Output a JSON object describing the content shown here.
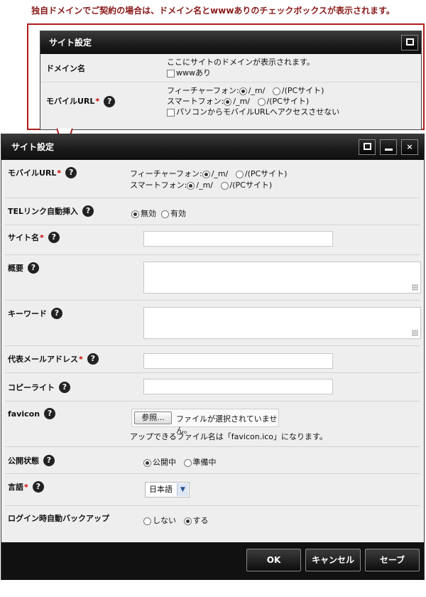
{
  "caption": "独自ドメインでご契約の場合は、ドメイン名とwwwありのチェックボックスが表示されます。",
  "back_panel": {
    "title": "サイト設定",
    "domain_label": "ドメイン名",
    "domain_text": "ここにサイトのドメインが表示されます。",
    "www_label": "wwwあり",
    "mobile_label": "モバイルURL",
    "feature_phone": "フィーチャーフォン:",
    "smart_phone": "スマートフォン:",
    "opt_m": "/_m/",
    "opt_pc": "/(PCサイト)",
    "no_pc_label": "パソコンからモバイルURLへアクセスさせない"
  },
  "window": {
    "title": "サイト設定"
  },
  "form": {
    "mobile_url": {
      "label": "モバイルURL",
      "feature_phone": "フィーチャーフォン:",
      "smart_phone": "スマートフォン:",
      "opt_m": "/_m/",
      "opt_pc": "/(PCサイト)"
    },
    "tel_link": {
      "label": "TELリンク自動挿入",
      "off": "無効",
      "on": "有効"
    },
    "site_name": {
      "label": "サイト名",
      "value": ""
    },
    "summary": {
      "label": "概要",
      "value": ""
    },
    "keyword": {
      "label": "キーワード",
      "value": ""
    },
    "email": {
      "label": "代表メールアドレス",
      "value": ""
    },
    "copyright": {
      "label": "コピーライト",
      "value": ""
    },
    "favicon": {
      "label": "favicon",
      "browse": "参照...",
      "no_file": "ファイルが選択されていません。",
      "note": "アップできるファイル名は「favicon.ico」になります。"
    },
    "publish": {
      "label": "公開状態",
      "opt1": "公開中",
      "opt2": "準備中"
    },
    "language": {
      "label": "言語",
      "selected": "日本語"
    },
    "auto_backup": {
      "label": "ログイン時自動バックアップ",
      "opt1": "しない",
      "opt2": "する"
    }
  },
  "footer": {
    "ok": "OK",
    "cancel": "キャンセル",
    "save": "セーブ"
  },
  "colors": {
    "caption": "#8a1a1a",
    "frame": "#b11c1c",
    "required": "#cc0000"
  }
}
